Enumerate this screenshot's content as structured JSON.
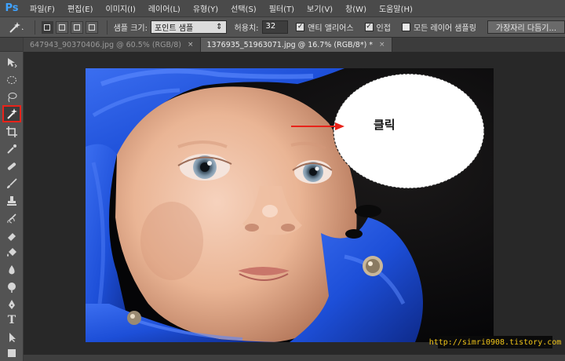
{
  "app": {
    "logo": "Ps"
  },
  "menu": [
    "파일(F)",
    "편집(E)",
    "이미지(I)",
    "레이어(L)",
    "유형(Y)",
    "선택(S)",
    "필터(T)",
    "보기(V)",
    "창(W)",
    "도움말(H)"
  ],
  "options": {
    "sample_size_label": "샘플 크기:",
    "sample_size_value": "포인트 샘플",
    "tolerance_label": "허용치:",
    "tolerance_value": "32",
    "antialias_label": "앤티 앨리어스",
    "antialias_checked": true,
    "contiguous_label": "인접",
    "contiguous_checked": true,
    "all_layers_label": "모든 레이어 샘플링",
    "all_layers_checked": false,
    "refine_edge_label": "가장자리 다듬기..."
  },
  "tabs": [
    {
      "label": "647943_90370406.jpg @ 60.5% (RGB/8)",
      "active": false
    },
    {
      "label": "1376935_51963071.jpg @ 16.7% (RGB/8*) *",
      "active": true
    }
  ],
  "tools": [
    {
      "name": "move-tool",
      "icon": "move-icon"
    },
    {
      "name": "marquee-tool",
      "icon": "ellipse-marquee-icon"
    },
    {
      "name": "lasso-tool",
      "icon": "lasso-icon"
    },
    {
      "name": "magic-wand-tool",
      "icon": "magic-wand-icon",
      "selected": true
    },
    {
      "name": "crop-tool",
      "icon": "crop-icon"
    },
    {
      "name": "eyedropper-tool",
      "icon": "eyedropper-icon"
    },
    {
      "name": "healing-brush-tool",
      "icon": "bandage-icon"
    },
    {
      "name": "brush-tool",
      "icon": "brush-icon"
    },
    {
      "name": "clone-stamp-tool",
      "icon": "stamp-icon"
    },
    {
      "name": "history-brush-tool",
      "icon": "history-brush-icon"
    },
    {
      "name": "eraser-tool",
      "icon": "eraser-icon"
    },
    {
      "name": "paint-bucket-tool",
      "icon": "bucket-icon"
    },
    {
      "name": "blur-tool",
      "icon": "drop-icon"
    },
    {
      "name": "dodge-tool",
      "icon": "dodge-icon"
    },
    {
      "name": "pen-tool",
      "icon": "pen-icon"
    },
    {
      "name": "type-tool",
      "icon": "type-icon",
      "glyph": "T"
    },
    {
      "name": "path-selection-tool",
      "icon": "arrow-icon"
    },
    {
      "name": "shape-tool",
      "icon": "shape-icon"
    },
    {
      "name": "hand-tool",
      "icon": "hand-icon"
    }
  ],
  "callout": {
    "text": "클릭"
  },
  "watermark": "http://simri0908.tistory.com",
  "colors": {
    "accent_red": "#e8231a",
    "ps_blue": "#3fa3ff",
    "jacket_blue": "#1d4fd8"
  }
}
